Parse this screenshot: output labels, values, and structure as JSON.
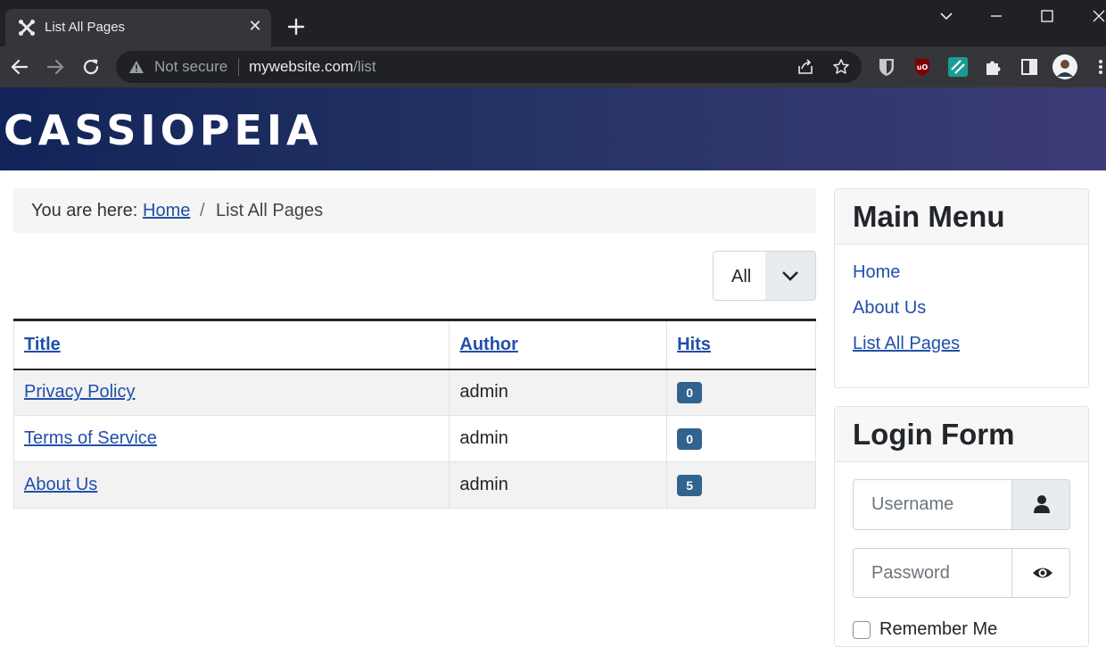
{
  "browser": {
    "tab_title": "List All Pages",
    "security_label": "Not secure",
    "url_host": "mywebsite.com",
    "url_path": "/list"
  },
  "site": {
    "brand": "CASSIOPEIA"
  },
  "breadcrumb": {
    "prefix": "You are here:",
    "home": "Home",
    "separator": "/",
    "current": "List All Pages"
  },
  "filter": {
    "selected": "All"
  },
  "table": {
    "headers": {
      "title": "Title",
      "author": "Author",
      "hits": "Hits"
    },
    "rows": [
      {
        "title": "Privacy Policy",
        "author": "admin",
        "hits": "0"
      },
      {
        "title": "Terms of Service",
        "author": "admin",
        "hits": "0"
      },
      {
        "title": "About Us",
        "author": "admin",
        "hits": "5"
      }
    ]
  },
  "main_menu": {
    "title": "Main Menu",
    "items": [
      "Home",
      "About Us",
      "List All Pages"
    ]
  },
  "login": {
    "title": "Login Form",
    "username_placeholder": "Username",
    "password_placeholder": "Password",
    "remember_label": "Remember Me"
  },
  "colors": {
    "link": "#224faa",
    "badge": "#30638e",
    "header_start": "#112459",
    "header_end": "#3d3c78"
  }
}
